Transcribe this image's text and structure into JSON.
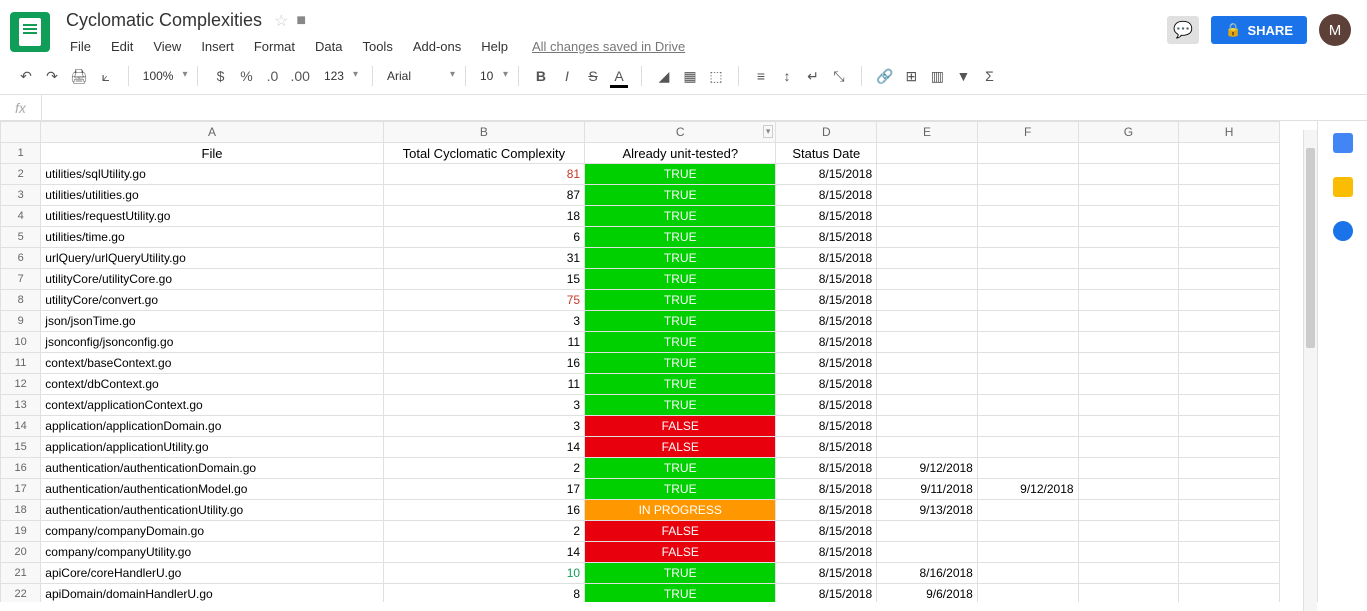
{
  "doc": {
    "title": "Cyclomatic Complexities",
    "saved": "All changes saved in Drive"
  },
  "menu": [
    "File",
    "Edit",
    "View",
    "Insert",
    "Format",
    "Data",
    "Tools",
    "Add-ons",
    "Help"
  ],
  "toolbar": {
    "zoom": "100%",
    "font": "Arial",
    "fontSize": "10",
    "share": "SHARE",
    "avatar": "M"
  },
  "columns": [
    "A",
    "B",
    "C",
    "D",
    "E",
    "F",
    "G",
    "H"
  ],
  "headers": {
    "A": "File",
    "B": "Total Cyclomatic Complexity",
    "C": "Already unit-tested?",
    "D": "Status Date"
  },
  "statusColors": {
    "TRUE": "#00d000",
    "FALSE": "#e8000d",
    "IN PROGRESS": "#ff9800"
  },
  "rows": [
    {
      "file": "utilities/sqlUtility.go",
      "complex": "81",
      "complexColor": "#c53929",
      "status": "TRUE",
      "d": "8/15/2018",
      "e": "",
      "f": ""
    },
    {
      "file": "utilities/utilities.go",
      "complex": "87",
      "complexColor": "#000",
      "status": "TRUE",
      "d": "8/15/2018",
      "e": "",
      "f": ""
    },
    {
      "file": "utilities/requestUtility.go",
      "complex": "18",
      "complexColor": "#000",
      "status": "TRUE",
      "d": "8/15/2018",
      "e": "",
      "f": ""
    },
    {
      "file": "utilities/time.go",
      "complex": "6",
      "complexColor": "#000",
      "status": "TRUE",
      "d": "8/15/2018",
      "e": "",
      "f": ""
    },
    {
      "file": "urlQuery/urlQueryUtility.go",
      "complex": "31",
      "complexColor": "#000",
      "status": "TRUE",
      "d": "8/15/2018",
      "e": "",
      "f": ""
    },
    {
      "file": "utilityCore/utilityCore.go",
      "complex": "15",
      "complexColor": "#000",
      "status": "TRUE",
      "d": "8/15/2018",
      "e": "",
      "f": ""
    },
    {
      "file": "utilityCore/convert.go",
      "complex": "75",
      "complexColor": "#c53929",
      "status": "TRUE",
      "d": "8/15/2018",
      "e": "",
      "f": ""
    },
    {
      "file": "json/jsonTime.go",
      "complex": "3",
      "complexColor": "#000",
      "status": "TRUE",
      "d": "8/15/2018",
      "e": "",
      "f": ""
    },
    {
      "file": "jsonconfig/jsonconfig.go",
      "complex": "11",
      "complexColor": "#000",
      "status": "TRUE",
      "d": "8/15/2018",
      "e": "",
      "f": ""
    },
    {
      "file": "context/baseContext.go",
      "complex": "16",
      "complexColor": "#000",
      "status": "TRUE",
      "d": "8/15/2018",
      "e": "",
      "f": ""
    },
    {
      "file": "context/dbContext.go",
      "complex": "11",
      "complexColor": "#000",
      "status": "TRUE",
      "d": "8/15/2018",
      "e": "",
      "f": ""
    },
    {
      "file": "context/applicationContext.go",
      "complex": "3",
      "complexColor": "#000",
      "status": "TRUE",
      "d": "8/15/2018",
      "e": "",
      "f": ""
    },
    {
      "file": "application/applicationDomain.go",
      "complex": "3",
      "complexColor": "#000",
      "status": "FALSE",
      "d": "8/15/2018",
      "e": "",
      "f": ""
    },
    {
      "file": "application/applicationUtility.go",
      "complex": "14",
      "complexColor": "#000",
      "status": "FALSE",
      "d": "8/15/2018",
      "e": "",
      "f": ""
    },
    {
      "file": "authentication/authenticationDomain.go",
      "complex": "2",
      "complexColor": "#000",
      "status": "TRUE",
      "d": "8/15/2018",
      "e": "9/12/2018",
      "f": ""
    },
    {
      "file": "authentication/authenticationModel.go",
      "complex": "17",
      "complexColor": "#000",
      "status": "TRUE",
      "d": "8/15/2018",
      "e": "9/11/2018",
      "f": "9/12/2018"
    },
    {
      "file": "authentication/authenticationUtility.go",
      "complex": "16",
      "complexColor": "#000",
      "status": "IN PROGRESS",
      "d": "8/15/2018",
      "e": "9/13/2018",
      "f": ""
    },
    {
      "file": "company/companyDomain.go",
      "complex": "2",
      "complexColor": "#000",
      "status": "FALSE",
      "d": "8/15/2018",
      "e": "",
      "f": ""
    },
    {
      "file": "company/companyUtility.go",
      "complex": "14",
      "complexColor": "#000",
      "status": "FALSE",
      "d": "8/15/2018",
      "e": "",
      "f": ""
    },
    {
      "file": "apiCore/coreHandlerU.go",
      "complex": "10",
      "complexColor": "#0f9d58",
      "status": "TRUE",
      "d": "8/15/2018",
      "e": "8/16/2018",
      "f": ""
    },
    {
      "file": "apiDomain/domainHandlerU.go",
      "complex": "8",
      "complexColor": "#000",
      "status": "TRUE",
      "d": "8/15/2018",
      "e": "9/6/2018",
      "f": ""
    }
  ]
}
